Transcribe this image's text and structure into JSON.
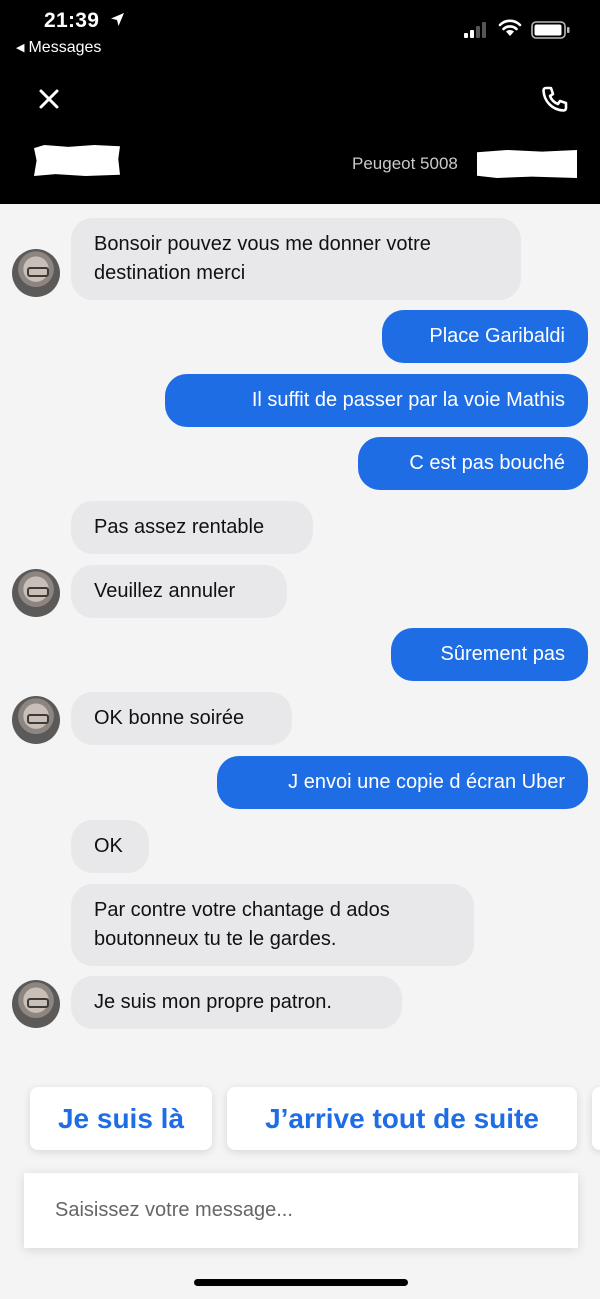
{
  "status_bar": {
    "time": "21:39",
    "back_label": "Messages"
  },
  "header": {
    "vehicle": "Peugeot 5008",
    "close_icon": "close-icon",
    "call_icon": "phone-icon"
  },
  "messages": [
    {
      "from": "driver",
      "lines": [
        "Bonsoir pouvez vous me donner votre",
        "destination merci"
      ]
    },
    {
      "from": "me",
      "lines": [
        "Place Garibaldi"
      ]
    },
    {
      "from": "me",
      "lines": [
        "Il suffit de passer par la voie Mathis"
      ]
    },
    {
      "from": "me",
      "lines": [
        "C est pas bouché"
      ]
    },
    {
      "from": "driver",
      "lines": [
        "Pas assez rentable"
      ]
    },
    {
      "from": "driver",
      "lines": [
        "Veuillez annuler"
      ]
    },
    {
      "from": "me",
      "lines": [
        "Sûrement pas"
      ]
    },
    {
      "from": "driver",
      "lines": [
        "OK bonne soirée"
      ]
    },
    {
      "from": "me",
      "lines": [
        "J envoi une copie d écran Uber"
      ]
    },
    {
      "from": "driver",
      "lines": [
        "OK"
      ]
    },
    {
      "from": "driver",
      "lines": [
        "Par contre votre chantage d ados",
        "boutonneux tu te le gardes."
      ]
    },
    {
      "from": "driver",
      "lines": [
        "Je suis mon propre patron."
      ]
    }
  ],
  "quick_replies": [
    "Je suis là",
    "J’arrive tout de suite"
  ],
  "composer": {
    "placeholder": "Saisissez votre message..."
  },
  "colors": {
    "accent": "#1e6de4",
    "incoming_bubble": "#e8e8ea",
    "header_bg": "#000000"
  }
}
